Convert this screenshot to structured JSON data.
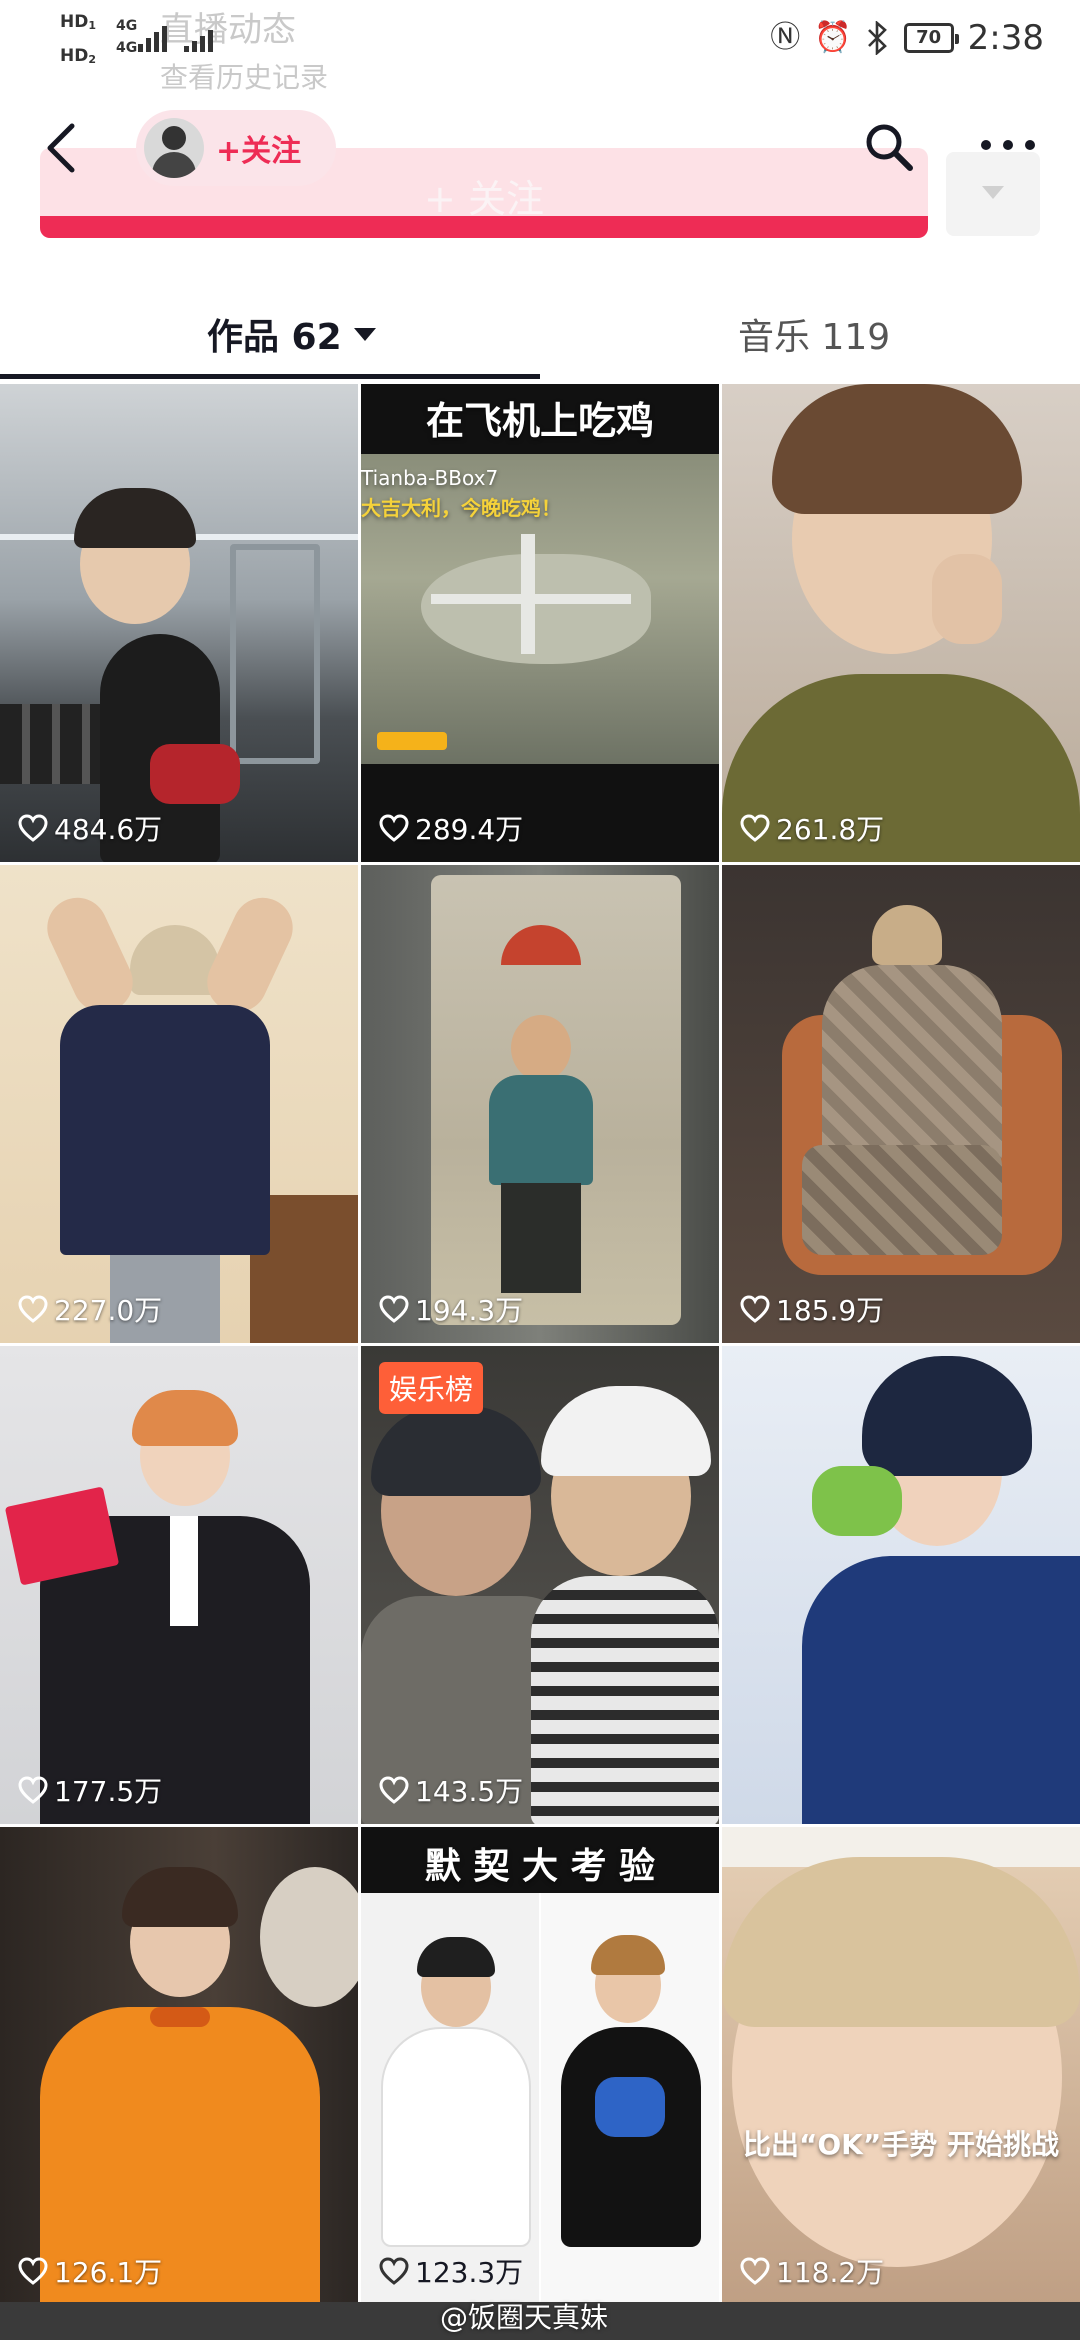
{
  "status_bar": {
    "signal_a": "HD",
    "signal_a_sub": "1",
    "signal_b": "HD",
    "signal_b_sub": "2",
    "network_a": "4G",
    "network_b": "4G",
    "ghost_title": "直播动态",
    "ghost_subtitle": "查看历史记录",
    "battery": "70",
    "time": "2:38"
  },
  "header": {
    "follow_label": "+关注",
    "ghost_follow_label": "+ 关注"
  },
  "tabs": {
    "works_label": "作品 62",
    "music_label": "音乐 119"
  },
  "videos": [
    {
      "likes": "484.6万"
    },
    {
      "likes": "289.4万",
      "overlay_title": "在飞机上吃鸡",
      "overlay_user": "Tianba-BBox7",
      "overlay_sub": "大吉大利，今晚吃鸡！"
    },
    {
      "likes": "261.8万"
    },
    {
      "likes": "227.0万"
    },
    {
      "likes": "194.3万"
    },
    {
      "likes": "185.9万"
    },
    {
      "likes": "177.5万"
    },
    {
      "likes": "143.5万",
      "badge": "娱乐榜"
    },
    {
      "likes": "",
      "likes_display": "",
      "hidden_likes": true
    },
    {
      "likes": "126.1万"
    },
    {
      "likes": "123.3万",
      "overlay_title": "默 契 大 考 验"
    },
    {
      "likes": "118.2万",
      "overlay_caption": "比出“OK”手势 开始挑战"
    }
  ],
  "watermark": "@饭圈天真妹",
  "colors": {
    "accent": "#ee2c55",
    "badge": "#fe5f38",
    "text_primary": "#161823"
  }
}
